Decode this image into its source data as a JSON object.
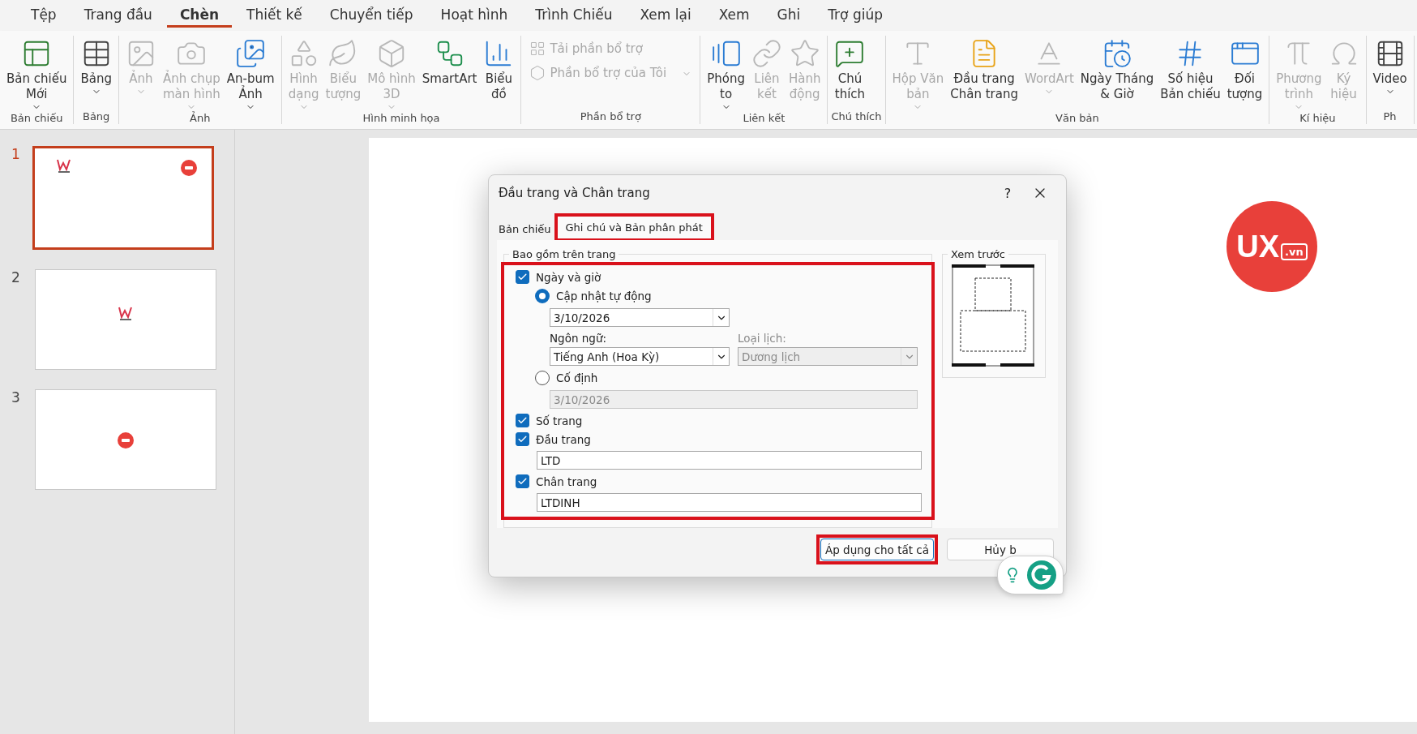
{
  "tabs": [
    {
      "label": "Tệp",
      "selected": false
    },
    {
      "label": "Trang đầu",
      "selected": false
    },
    {
      "label": "Chèn",
      "selected": true
    },
    {
      "label": "Thiết kế",
      "selected": false
    },
    {
      "label": "Chuyển tiếp",
      "selected": false
    },
    {
      "label": "Hoạt hình",
      "selected": false
    },
    {
      "label": "Trình Chiếu",
      "selected": false
    },
    {
      "label": "Xem lại",
      "selected": false
    },
    {
      "label": "Xem",
      "selected": false
    },
    {
      "label": "Ghi",
      "selected": false
    },
    {
      "label": "Trợ giúp",
      "selected": false
    }
  ],
  "ribbon": {
    "groups": [
      {
        "label": "Bản chiếu",
        "items": [
          {
            "kind": "large",
            "label": "Bản chiếu\nMới",
            "disabled": false,
            "dropdown": true
          }
        ]
      },
      {
        "label": "Bảng",
        "items": [
          {
            "kind": "large",
            "label": "Bảng",
            "disabled": false,
            "dropdown": true
          }
        ]
      },
      {
        "label": "Ảnh",
        "items": [
          {
            "kind": "large",
            "label": "Ảnh",
            "disabled": true,
            "dropdown": true
          },
          {
            "kind": "large",
            "label": "Ảnh chụp\nmàn hình",
            "disabled": true,
            "dropdown": true
          },
          {
            "kind": "large",
            "label": "An-bum\nẢnh",
            "disabled": false,
            "dropdown": true
          }
        ]
      },
      {
        "label": "Hình minh họa",
        "items": [
          {
            "kind": "large",
            "label": "Hình\ndạng",
            "disabled": true,
            "dropdown": true
          },
          {
            "kind": "large",
            "label": "Biểu\ntượng",
            "disabled": true,
            "dropdown": false
          },
          {
            "kind": "large",
            "label": "Mô hình\n3D",
            "disabled": true,
            "dropdown": true
          },
          {
            "kind": "large",
            "label": "SmartArt",
            "disabled": false,
            "dropdown": false
          },
          {
            "kind": "large",
            "label": "Biểu\nđồ",
            "disabled": false,
            "dropdown": false
          }
        ]
      },
      {
        "label": "Phần bổ trợ",
        "items": [
          {
            "kind": "small",
            "label": "Tải phần bổ trợ",
            "disabled": true,
            "dropdown": false
          },
          {
            "kind": "small",
            "label": "Phần bổ trợ của Tôi",
            "disabled": true,
            "dropdown": true
          }
        ]
      },
      {
        "label": "Liên kết",
        "items": [
          {
            "kind": "large",
            "label": "Phóng\nto",
            "disabled": false,
            "dropdown": true
          },
          {
            "kind": "large",
            "label": "Liên\nkết",
            "disabled": true,
            "dropdown": false
          },
          {
            "kind": "large",
            "label": "Hành\nđộng",
            "disabled": true,
            "dropdown": false
          }
        ]
      },
      {
        "label": "Chú thích",
        "items": [
          {
            "kind": "large",
            "label": "Chú\nthích",
            "disabled": false,
            "dropdown": false
          }
        ]
      },
      {
        "label": "Văn bản",
        "items": [
          {
            "kind": "large",
            "label": "Hộp Văn\nbản",
            "disabled": true,
            "dropdown": true
          },
          {
            "kind": "large",
            "label": "Đầu trang\nChân trang",
            "disabled": false,
            "dropdown": false
          },
          {
            "kind": "large",
            "label": "WordArt",
            "disabled": true,
            "dropdown": true
          },
          {
            "kind": "large",
            "label": "Ngày Tháng\n& Giờ",
            "disabled": false,
            "dropdown": false
          },
          {
            "kind": "large",
            "label": "Số hiệu\nBản chiếu",
            "disabled": false,
            "dropdown": false
          },
          {
            "kind": "large",
            "label": "Đối\ntượng",
            "disabled": false,
            "dropdown": false
          }
        ]
      },
      {
        "label": "Kí hiệu",
        "items": [
          {
            "kind": "large",
            "label": "Phương\ntrình",
            "disabled": true,
            "dropdown": true
          },
          {
            "kind": "large",
            "label": "Ký\nhiệu",
            "disabled": true,
            "dropdown": false
          }
        ]
      },
      {
        "label": "Ph",
        "items": [
          {
            "kind": "large",
            "label": "Video",
            "disabled": false,
            "dropdown": true
          }
        ]
      }
    ]
  },
  "slides": [
    {
      "number": "1",
      "selected": true,
      "kind": "both"
    },
    {
      "number": "2",
      "selected": false,
      "kind": "mark"
    },
    {
      "number": "3",
      "selected": false,
      "kind": "badge"
    }
  ],
  "slide": {
    "logo": {
      "main": "UX",
      "suffix": ".vn"
    }
  },
  "dialog": {
    "title": "Đầu trang và Chân trang",
    "help": "?",
    "tabs": [
      {
        "label": "Bản chiếu",
        "selected": false,
        "highlighted": false
      },
      {
        "label": "Ghi chú và Bản phân phát",
        "selected": true,
        "highlighted": true
      }
    ],
    "section": {
      "legend": "Bao gồm trên trang",
      "highlighted": true,
      "date_time": {
        "label": "Ngày và giờ",
        "checked": true
      },
      "auto_update": {
        "label": "Cập nhật tự động",
        "selected": true,
        "value": "3/10/2026"
      },
      "language": {
        "label": "Ngôn ngữ:",
        "value": "Tiếng Anh (Hoa Kỳ)"
      },
      "calendar": {
        "label": "Loại lịch:",
        "value": "Dương lịch",
        "disabled": true
      },
      "fixed": {
        "label": "Cố định",
        "selected": false,
        "value": "3/10/2026",
        "disabled": true
      },
      "page_number": {
        "label": "Số trang",
        "checked": true
      },
      "header": {
        "label": "Đầu trang",
        "checked": true,
        "value": "LTD"
      },
      "footer": {
        "label": "Chân trang",
        "checked": true,
        "value": "LTDINH"
      }
    },
    "preview": {
      "legend": "Xem trước"
    },
    "buttons": [
      {
        "label": "Áp dụng cho tất cả",
        "highlighted": true
      },
      {
        "label": "Hủy b",
        "highlighted": false
      }
    ]
  }
}
